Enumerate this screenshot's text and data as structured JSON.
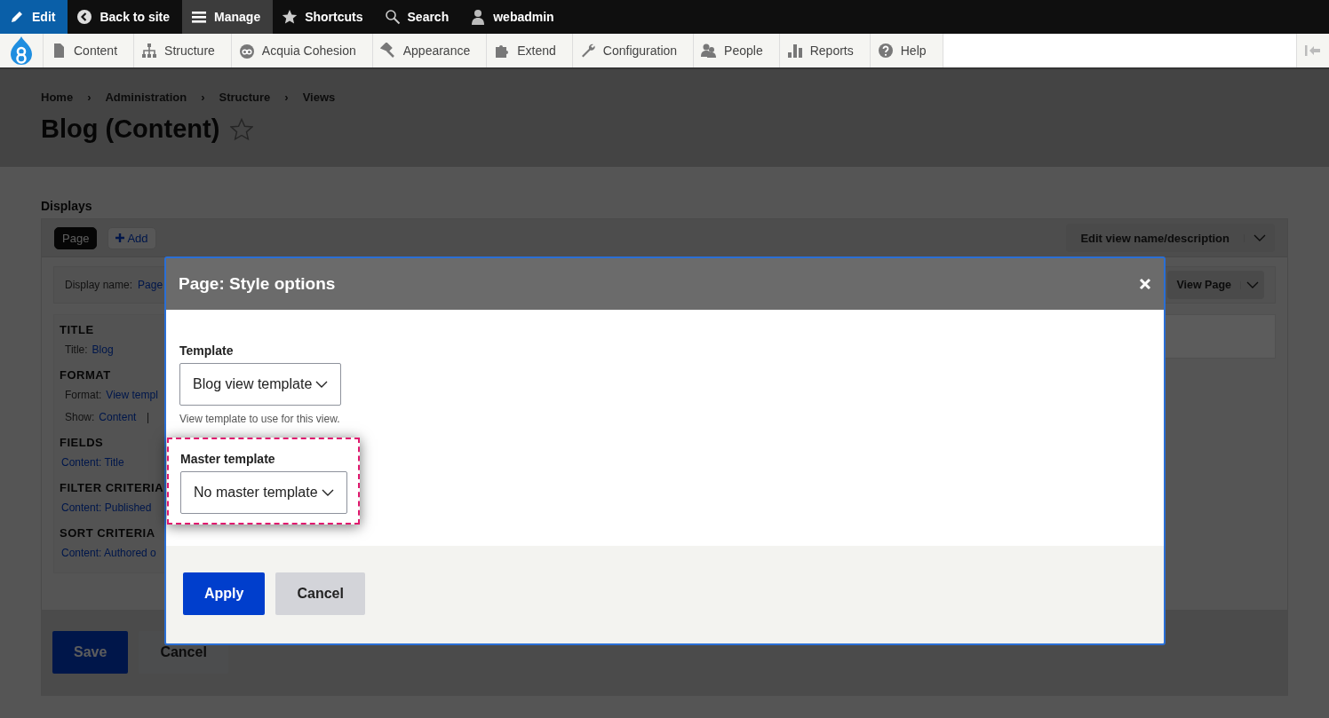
{
  "toolbar": {
    "items": [
      {
        "label": "Edit",
        "kind": "toggle",
        "on": true
      },
      {
        "label": "Back to site",
        "kind": "tab",
        "selected": false
      },
      {
        "label": "Manage",
        "kind": "tab",
        "selected": true
      },
      {
        "label": "Shortcuts",
        "kind": "tab",
        "selected": false
      },
      {
        "label": "Search",
        "kind": "tab",
        "selected": false
      },
      {
        "label": "webadmin",
        "kind": "tab",
        "selected": false
      }
    ]
  },
  "tray": {
    "items": [
      {
        "label": "Content"
      },
      {
        "label": "Structure"
      },
      {
        "label": "Acquia Cohesion"
      },
      {
        "label": "Appearance"
      },
      {
        "label": "Extend"
      },
      {
        "label": "Configuration"
      },
      {
        "label": "People"
      },
      {
        "label": "Reports"
      },
      {
        "label": "Help"
      }
    ]
  },
  "breadcrumb": {
    "separator": "›",
    "items": [
      "Home",
      "Administration",
      "Structure",
      "Views"
    ]
  },
  "page_title": "Blog (Content)",
  "displays": {
    "heading": "Displays",
    "tabs": [
      {
        "label": "Page",
        "selected": true
      },
      {
        "label": "Add",
        "selected": false
      }
    ],
    "edit_button": "Edit view name/description"
  },
  "display_name": {
    "label": "Display name:",
    "value": "Page"
  },
  "view_page_button": "View Page",
  "sections": [
    {
      "title": "TITLE",
      "rows": [
        {
          "label": "Title:",
          "link": "Blog"
        }
      ]
    },
    {
      "title": "FORMAT",
      "rows": [
        {
          "label": "Format:",
          "link": "View templ"
        },
        {
          "label": "Show:",
          "link": "Content",
          "separator": "|"
        }
      ]
    },
    {
      "title": "FIELDS",
      "rows": [
        {
          "link": "Content: Title"
        }
      ]
    },
    {
      "title": "FILTER CRITERIA",
      "rows": [
        {
          "link": "Content: Published"
        }
      ]
    },
    {
      "title": "SORT CRITERIA",
      "rows": [
        {
          "link": "Content: Authored o"
        }
      ]
    }
  ],
  "actions": [
    {
      "label": "Save",
      "kind": "primary"
    },
    {
      "label": "Cancel",
      "kind": "secondary"
    }
  ],
  "dialog": {
    "title": "Page: Style options",
    "fields": [
      {
        "label": "Template",
        "value": "Blog view template",
        "description": "View template to use for this view.",
        "highlighted": false
      },
      {
        "label": "Master template",
        "value": "No master template",
        "highlighted": true
      }
    ],
    "buttons": [
      {
        "label": "Apply",
        "kind": "primary"
      },
      {
        "label": "Cancel",
        "kind": "secondary"
      }
    ]
  }
}
